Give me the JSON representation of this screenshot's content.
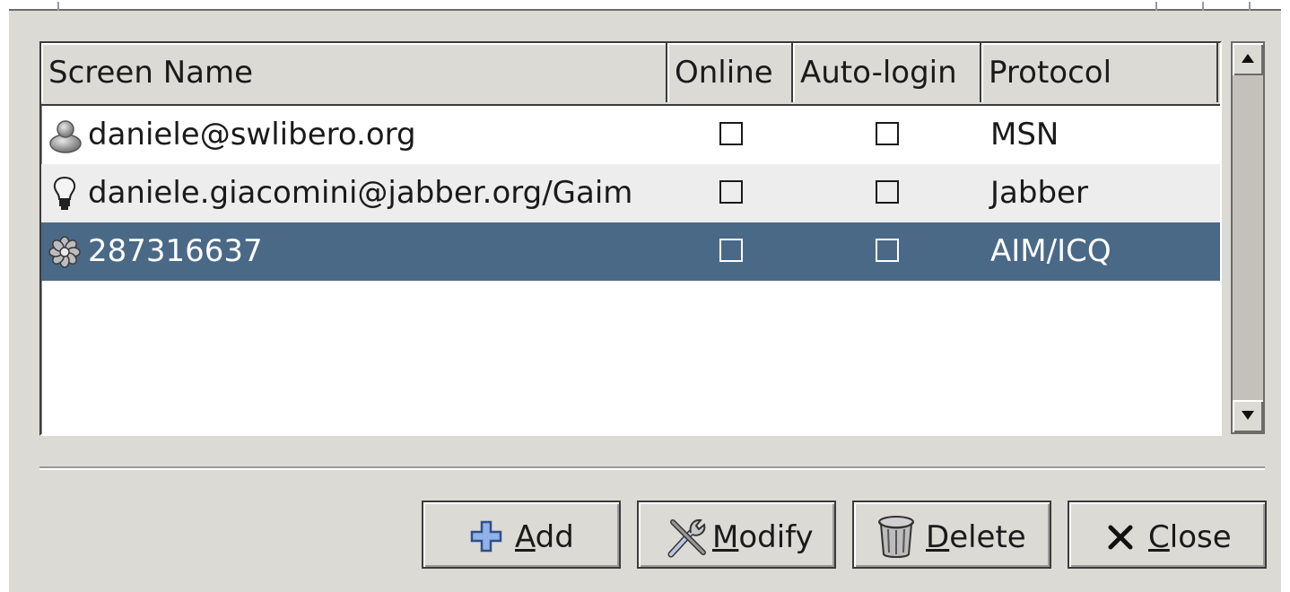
{
  "columns": {
    "screen_name": "Screen Name",
    "online": "Online",
    "auto_login": "Auto-login",
    "protocol": "Protocol"
  },
  "accounts": [
    {
      "screen_name": "daniele@swlibero.org",
      "online": false,
      "auto_login": false,
      "protocol": "MSN",
      "icon": "msn-buddy-icon",
      "selected": false
    },
    {
      "screen_name": "daniele.giacomini@jabber.org/Gaim",
      "online": false,
      "auto_login": false,
      "protocol": "Jabber",
      "icon": "jabber-lightbulb-icon",
      "selected": false
    },
    {
      "screen_name": "287316637",
      "online": false,
      "auto_login": false,
      "protocol": "AIM/ICQ",
      "icon": "icq-flower-icon",
      "selected": true
    }
  ],
  "buttons": {
    "add": {
      "mnemonic": "A",
      "rest": "dd",
      "icon": "plus-icon"
    },
    "modify": {
      "mnemonic": "M",
      "rest": "odify",
      "icon": "tools-icon"
    },
    "delete": {
      "mnemonic": "D",
      "rest": "elete",
      "icon": "trash-icon"
    },
    "close": {
      "mnemonic": "C",
      "rest": "lose",
      "icon": "close-x-icon"
    }
  },
  "colors": {
    "selection": "#4a6987",
    "window_bg": "#dcdad5",
    "alt_row": "#ededed"
  }
}
